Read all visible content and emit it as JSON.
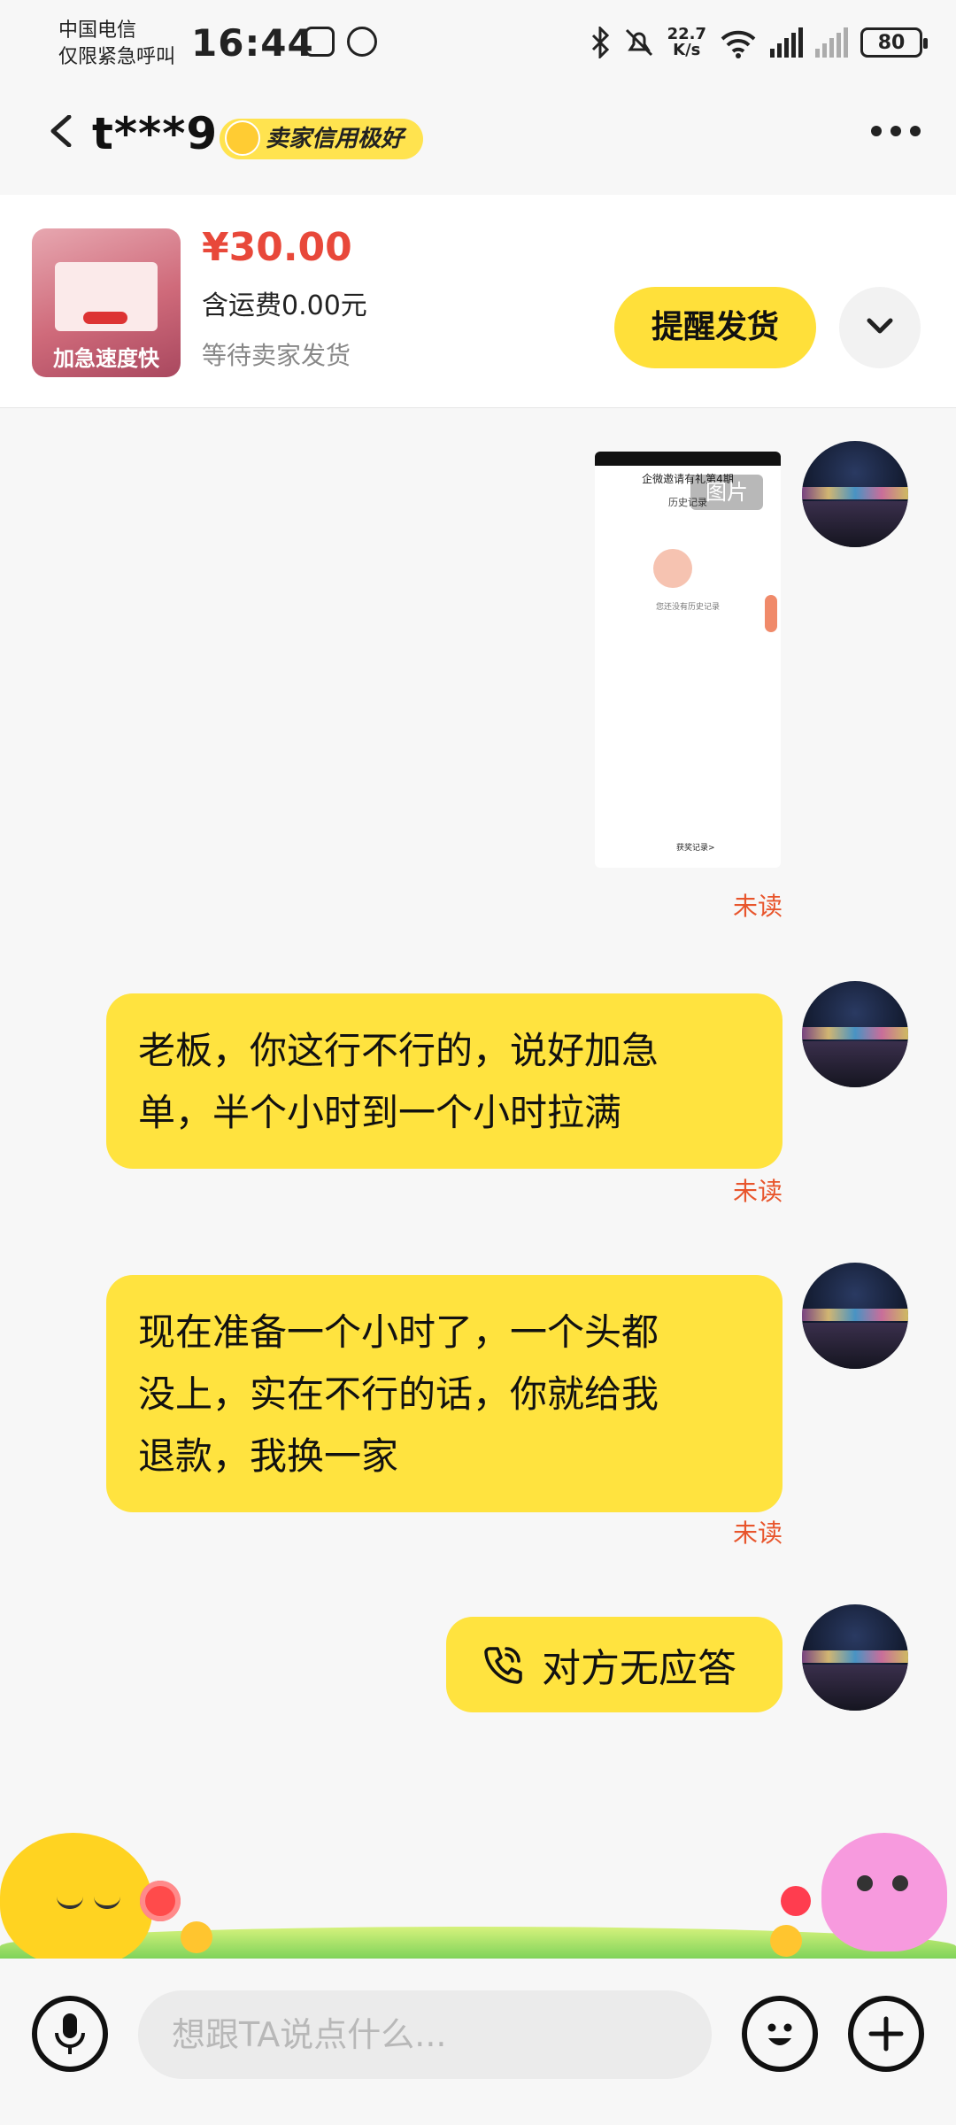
{
  "status_bar": {
    "carrier_line1": "中国电信",
    "carrier_line2": "仅限紧急呼叫",
    "time": "16:44",
    "net_speed_value": "22.7",
    "net_speed_unit": "K/s",
    "battery": "80",
    "icons": [
      "nfc-icon",
      "alarm-icon",
      "bluetooth-icon",
      "mute-icon",
      "wifi-icon",
      "5g-signal-icon",
      "no-signal-icon",
      "battery-icon"
    ]
  },
  "header": {
    "name": "t***9",
    "badge": "卖家信用极好",
    "icons": [
      "back-icon",
      "more-icon"
    ]
  },
  "product": {
    "thumb_label": "加急速度快",
    "price": "¥30.00",
    "shipping": "含运费0.00元",
    "status": "等待卖家发货",
    "remind_button": "提醒发货"
  },
  "messages": [
    {
      "type": "image",
      "tag": "图片",
      "mini_title": "企微邀请有礼第4期",
      "mini_sub": "历史记录",
      "mini_note": "您还没有历史记录",
      "mini_foot": "获奖记录>",
      "read_status": "未读"
    },
    {
      "type": "text",
      "lines": [
        "老板，你这行不行的，说好加急",
        "单，半个小时到一个小时拉满"
      ],
      "read_status": "未读"
    },
    {
      "type": "text",
      "lines": [
        "现在准备一个小时了，一个头都",
        "没上，实在不行的话，你就给我",
        "退款，我换一家"
      ],
      "read_status": "未读"
    },
    {
      "type": "call",
      "text": "对方无应答"
    }
  ],
  "input": {
    "placeholder": "想跟TA说点什么..."
  },
  "colors": {
    "accent_yellow": "#ffe33f",
    "price_red": "#e8483a",
    "unread_orange": "#e8552c"
  }
}
